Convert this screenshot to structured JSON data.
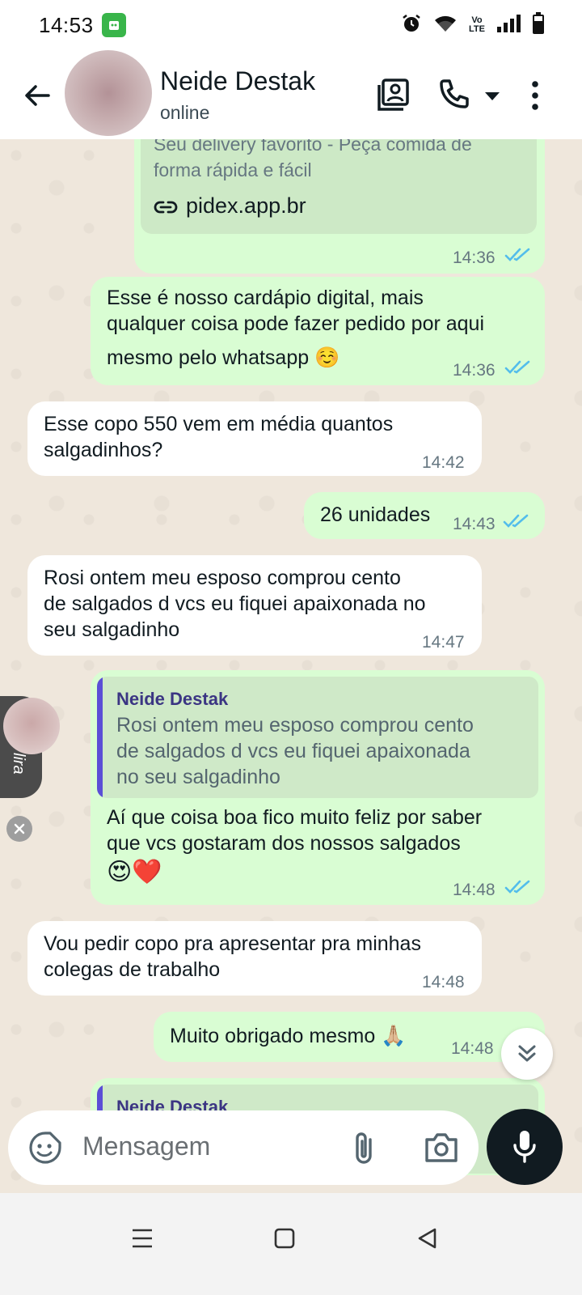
{
  "status_bar": {
    "time": "14:53",
    "volte_label_top": "Vo",
    "volte_label_bottom": "LTE",
    "icons": [
      "alarm-icon",
      "wifi-icon",
      "volte-icon",
      "signal-icon",
      "battery-icon"
    ]
  },
  "header": {
    "contact_name": "Neide Destak",
    "contact_status": "online",
    "icons": [
      "back-arrow-icon",
      "contact-card-icon",
      "phone-icon",
      "dropdown-icon",
      "more-icon"
    ]
  },
  "messages": [
    {
      "direction": "out",
      "link_description_line1": "Seu delivery favorito - Peça comida de",
      "link_description_line2": "forma rápida e fácil",
      "link_url": "pidex.app.br",
      "time": "14:36",
      "read": true
    },
    {
      "direction": "out",
      "text_line1": "Esse é nosso cardápio digital, mais",
      "text_line2": "qualquer coisa pode fazer pedido por aqui",
      "text_line3": "mesmo pelo whatsapp ☺️",
      "time": "14:36",
      "read": true
    },
    {
      "direction": "in",
      "text_line1": "Esse  copo 550  vem em média quantos",
      "text_line2": "salgadinhos?",
      "time": "14:42"
    },
    {
      "direction": "out",
      "text_line1": "26 unidades",
      "time": "14:43",
      "read": true
    },
    {
      "direction": "in",
      "text_line1": "Rosi ontem meu esposo comprou cento",
      "text_line2": "de salgados d vcs eu fiquei apaixonada no",
      "text_line3": "seu salgadinho",
      "time": "14:47"
    },
    {
      "direction": "out",
      "quote_author": "Neide Destak",
      "quote_line1": "Rosi ontem meu esposo comprou cento",
      "quote_line2": "de salgados d vcs eu fiquei apaixonada",
      "quote_line3": "no seu salgadinho",
      "text_line1": "Aí que coisa boa fico muito feliz por saber",
      "text_line2": "que vcs gostaram dos nossos salgados",
      "text_line3": "😍❤️",
      "time": "14:48",
      "read": true
    },
    {
      "direction": "in",
      "text_line1": "Vou pedir copo pra apresentar pra minhas",
      "text_line2": "colegas de trabalho",
      "time": "14:48"
    },
    {
      "direction": "out",
      "text_line1": "Muito obrigado mesmo 🙏🏼",
      "time": "14:48",
      "read": true
    },
    {
      "direction": "out",
      "quote_author": "Neide Destak"
    }
  ],
  "floating_badge": {
    "label": "lira"
  },
  "composer": {
    "placeholder": "Mensagem",
    "icons": [
      "sticker-icon",
      "attach-icon",
      "camera-icon",
      "mic-icon"
    ]
  },
  "nav_bar": {
    "icons": [
      "menu-icon",
      "home-icon",
      "back-icon"
    ]
  },
  "colors": {
    "outgoing_bubble": "#d9fdd3",
    "incoming_bubble": "#ffffff",
    "read_ticks": "#53bdeb",
    "chat_background": "#efe7dc",
    "quote_bar": "#5b4fd6"
  }
}
